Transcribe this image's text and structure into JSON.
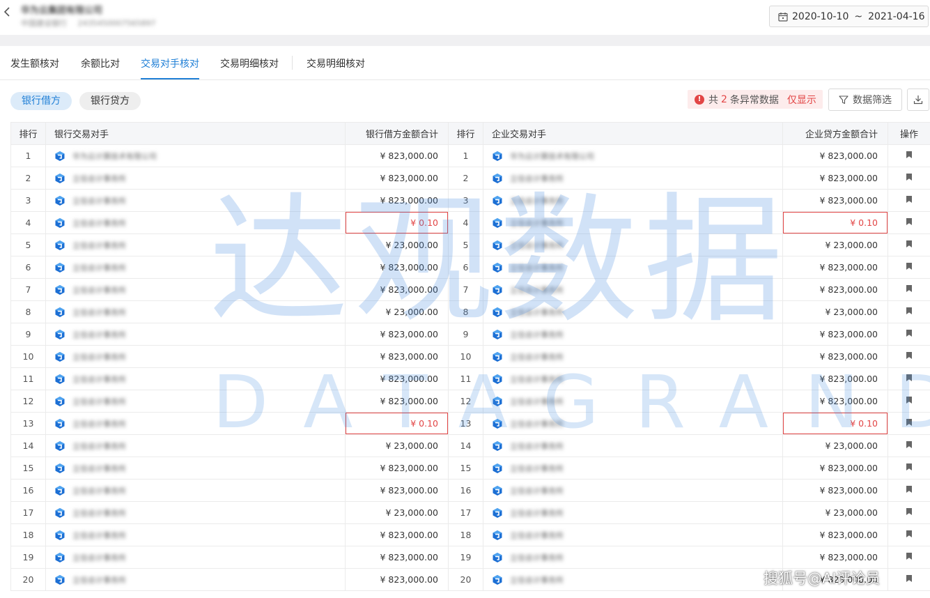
{
  "header": {
    "company_name": "华为云集团有限公司",
    "bank_name": "中国建设银行",
    "account_no": "2435450007565897",
    "date_start": "2020-10-10",
    "date_sep": "~",
    "date_end": "2021-04-16"
  },
  "tabs": [
    "发生额核对",
    "余额比对",
    "交易对手核对",
    "交易明细核对",
    "交易明细核对"
  ],
  "active_tab_index": 2,
  "filters": {
    "debit_label": "银行借方",
    "credit_label": "银行贷方",
    "alert_prefix": "共",
    "alert_count": "2",
    "alert_suffix": "条异常数据",
    "alert_only": "仅显示",
    "filter_label": "数据筛选"
  },
  "table": {
    "headers": {
      "rank": "排行",
      "bank_cp": "银行交易对手",
      "bank_amount": "银行借方金额合计",
      "rank2": "排行",
      "ent_cp": "企业交易对手",
      "ent_amount": "企业贷方金额合计",
      "op": "操作"
    },
    "rows": [
      {
        "rank": "1",
        "bank_cp": "华为云计算技术有限公司",
        "bank_amount": "¥ 823,000.00",
        "ent_cp": "华为云计算技术有限公司",
        "ent_amount": "¥ 823,000.00",
        "anomaly": false
      },
      {
        "rank": "2",
        "bank_cp": "立信会计事务所",
        "bank_amount": "¥ 823,000.00",
        "ent_cp": "立信会计事务所",
        "ent_amount": "¥ 823,000.00",
        "anomaly": false
      },
      {
        "rank": "3",
        "bank_cp": "立信会计事务所",
        "bank_amount": "¥ 823,000.00",
        "ent_cp": "立信会计事务所",
        "ent_amount": "¥ 823,000.00",
        "anomaly": false
      },
      {
        "rank": "4",
        "bank_cp": "立信会计事务所",
        "bank_amount": "¥ 0.10",
        "ent_cp": "立信会计事务所",
        "ent_amount": "¥ 0.10",
        "anomaly": true
      },
      {
        "rank": "5",
        "bank_cp": "立信会计事务所",
        "bank_amount": "¥ 23,000.00",
        "ent_cp": "立信会计事务所",
        "ent_amount": "¥ 23,000.00",
        "anomaly": false
      },
      {
        "rank": "6",
        "bank_cp": "立信会计事务所",
        "bank_amount": "¥ 823,000.00",
        "ent_cp": "立信会计事务所",
        "ent_amount": "¥ 823,000.00",
        "anomaly": false
      },
      {
        "rank": "7",
        "bank_cp": "立信会计事务所",
        "bank_amount": "¥ 823,000.00",
        "ent_cp": "立信会计事务所",
        "ent_amount": "¥ 823,000.00",
        "anomaly": false
      },
      {
        "rank": "8",
        "bank_cp": "立信会计事务所",
        "bank_amount": "¥ 23,000.00",
        "ent_cp": "立信会计事务所",
        "ent_amount": "¥ 23,000.00",
        "anomaly": false
      },
      {
        "rank": "9",
        "bank_cp": "立信会计事务所",
        "bank_amount": "¥ 823,000.00",
        "ent_cp": "立信会计事务所",
        "ent_amount": "¥ 823,000.00",
        "anomaly": false
      },
      {
        "rank": "10",
        "bank_cp": "立信会计事务所",
        "bank_amount": "¥ 823,000.00",
        "ent_cp": "立信会计事务所",
        "ent_amount": "¥ 823,000.00",
        "anomaly": false
      },
      {
        "rank": "11",
        "bank_cp": "立信会计事务所",
        "bank_amount": "¥ 823,000.00",
        "ent_cp": "立信会计事务所",
        "ent_amount": "¥ 823,000.00",
        "anomaly": false
      },
      {
        "rank": "12",
        "bank_cp": "立信会计事务所",
        "bank_amount": "¥ 823,000.00",
        "ent_cp": "立信会计事务所",
        "ent_amount": "¥ 823,000.00",
        "anomaly": false
      },
      {
        "rank": "13",
        "bank_cp": "立信会计事务所",
        "bank_amount": "¥ 0.10",
        "ent_cp": "立信会计事务所",
        "ent_amount": "¥ 0.10",
        "anomaly": true
      },
      {
        "rank": "14",
        "bank_cp": "立信会计事务所",
        "bank_amount": "¥ 23,000.00",
        "ent_cp": "立信会计事务所",
        "ent_amount": "¥ 23,000.00",
        "anomaly": false
      },
      {
        "rank": "15",
        "bank_cp": "立信会计事务所",
        "bank_amount": "¥ 823,000.00",
        "ent_cp": "立信会计事务所",
        "ent_amount": "¥ 823,000.00",
        "anomaly": false
      },
      {
        "rank": "16",
        "bank_cp": "立信会计事务所",
        "bank_amount": "¥ 823,000.00",
        "ent_cp": "立信会计事务所",
        "ent_amount": "¥ 823,000.00",
        "anomaly": false
      },
      {
        "rank": "17",
        "bank_cp": "立信会计事务所",
        "bank_amount": "¥ 23,000.00",
        "ent_cp": "立信会计事务所",
        "ent_amount": "¥ 23,000.00",
        "anomaly": false
      },
      {
        "rank": "18",
        "bank_cp": "立信会计事务所",
        "bank_amount": "¥ 823,000.00",
        "ent_cp": "立信会计事务所",
        "ent_amount": "¥ 823,000.00",
        "anomaly": false
      },
      {
        "rank": "19",
        "bank_cp": "立信会计事务所",
        "bank_amount": "¥ 823,000.00",
        "ent_cp": "立信会计事务所",
        "ent_amount": "¥ 823,000.00",
        "anomaly": false
      },
      {
        "rank": "20",
        "bank_cp": "立信会计事务所",
        "bank_amount": "¥ 823,000.00",
        "ent_cp": "立信会计事务所",
        "ent_amount": "¥ 823,000.00",
        "anomaly": false
      }
    ]
  },
  "watermark": {
    "line1": "达观数据",
    "line2": "DATAGRAND"
  },
  "credit": "搜狐号@AI评论员",
  "colors": {
    "accent": "#1f7fd6",
    "anomaly": "#e24545",
    "header_bg": "#f5f6f8"
  }
}
